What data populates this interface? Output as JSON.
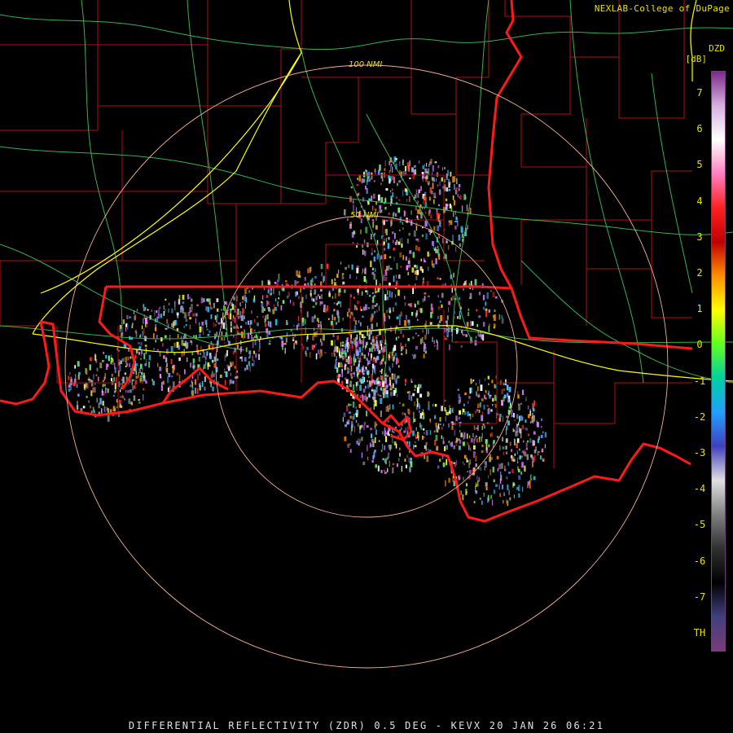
{
  "credit": "NEXLAB-College of DuPage",
  "colorbar": {
    "product": "DZD",
    "unit": "[dB]",
    "ticks": [
      "7",
      "6",
      "5",
      "4",
      "3",
      "2",
      "1",
      "0",
      "-1",
      "-2",
      "-3",
      "-4",
      "-5",
      "-6",
      "-7",
      "TH"
    ],
    "gradient_colors": [
      "#7a2a8a",
      "#d8b0e0",
      "#ffffff",
      "#ff80c0",
      "#ff2020",
      "#c00000",
      "#ff9000",
      "#ffff00",
      "#60ff20",
      "#00d0a0",
      "#20a0ff",
      "#4040c0",
      "#e0e0e0",
      "#808080",
      "#303030",
      "#000000",
      "#404080",
      "#7a3b7a"
    ]
  },
  "range_rings": {
    "inner_label": "50 NMI",
    "outer_label": "100 NMI"
  },
  "footer": "DIFFERENTIAL REFLECTIVITY (ZDR) 0.5 DEG - KEVX 20 JAN 26 06:21",
  "colors": {
    "state_border": "#ff1a1a",
    "county_lines": "#b01010",
    "highways": "#40d060",
    "interstates": "#ffff00",
    "range_ring": "#f0b090",
    "text": "#e8e000"
  }
}
